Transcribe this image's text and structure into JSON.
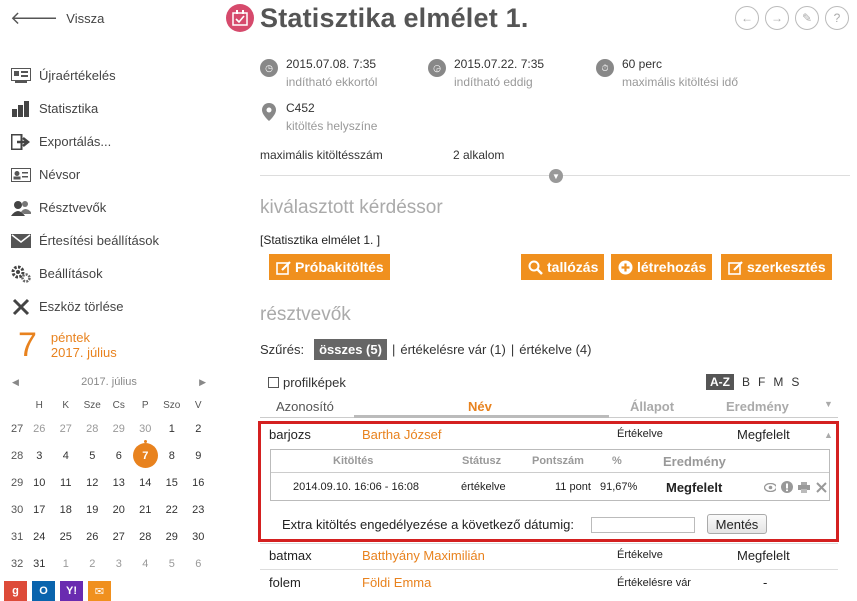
{
  "nav": {
    "back_label": "Vissza",
    "menu": [
      {
        "label": "Újraértékelés",
        "icon": "reevaluate-icon"
      },
      {
        "label": "Statisztika",
        "icon": "bar-chart-icon"
      },
      {
        "label": "Exportálás...",
        "icon": "export-icon"
      },
      {
        "label": "Névsor",
        "icon": "id-card-icon"
      },
      {
        "label": "Résztvevők",
        "icon": "users-icon"
      },
      {
        "label": "Értesítési beállítások",
        "icon": "envelope-icon"
      },
      {
        "label": "Beállítások",
        "icon": "gear-icon"
      },
      {
        "label": "Eszköz törlése",
        "icon": "close-icon"
      }
    ]
  },
  "today": {
    "day": "7",
    "weekday": "péntek",
    "date": "2017. július"
  },
  "calendar": {
    "month_label": "2017. július",
    "prev": "◀",
    "next": "▶",
    "headers": [
      "H",
      "K",
      "Sze",
      "Cs",
      "P",
      "Szo",
      "V"
    ],
    "weeks": [
      {
        "num": "27",
        "days": [
          "26",
          "27",
          "28",
          "29",
          "30",
          "1",
          "2"
        ]
      },
      {
        "num": "28",
        "days": [
          "3",
          "4",
          "5",
          "6",
          "7",
          "8",
          "9"
        ]
      },
      {
        "num": "29",
        "days": [
          "10",
          "11",
          "12",
          "13",
          "14",
          "15",
          "16"
        ]
      },
      {
        "num": "30",
        "days": [
          "17",
          "18",
          "19",
          "20",
          "21",
          "22",
          "23"
        ]
      },
      {
        "num": "31",
        "days": [
          "24",
          "25",
          "26",
          "27",
          "28",
          "29",
          "30"
        ]
      },
      {
        "num": "32",
        "days": [
          "31",
          "1",
          "2",
          "3",
          "4",
          "5",
          "6"
        ]
      }
    ],
    "selected": "7"
  },
  "share": [
    {
      "icon": "google-icon",
      "label": "g",
      "color": "#dd4b39"
    },
    {
      "icon": "outlook-icon",
      "label": "O",
      "color": "#0a64ad"
    },
    {
      "icon": "yahoo-icon",
      "label": "Y!",
      "color": "#6a2bb0"
    },
    {
      "icon": "mail-icon",
      "label": "✉",
      "color": "#f0901e"
    }
  ],
  "page": {
    "title": "Statisztika elmélet 1.",
    "toolbar": [
      "←",
      "→",
      "✎",
      "?"
    ]
  },
  "meta": {
    "start": {
      "value": "2015.07.08. 7:35",
      "label": "indítható ekkortól"
    },
    "end": {
      "value": "2015.07.22. 7:35",
      "label": "indítható eddig"
    },
    "duration": {
      "value": "60 perc",
      "label": "maximális kitöltési idő"
    },
    "location": {
      "value": "C452",
      "label": "kitöltés helyszíne"
    },
    "max_fill_label": "maximális kitöltésszám",
    "max_fill_value": "2 alkalom"
  },
  "questionnaire": {
    "section_title": "kiválasztott kérdéssor",
    "name": "[Statisztika elmélet 1. ]",
    "buttons": {
      "trial": "Próbakitöltés",
      "browse": "tallózás",
      "create": "létrehozás",
      "edit": "szerkesztés"
    }
  },
  "participants": {
    "section_title": "résztvevők",
    "filter_label": "Szűrés:",
    "filter_all": "összes (5)",
    "filter_waiting": "értékelésre vár (1)",
    "filter_done": "értékelve (4)",
    "sep": "|",
    "profile_images": "profilképek",
    "sort": [
      "A-Z",
      "B",
      "F",
      "M",
      "S"
    ],
    "columns": {
      "id": "Azonosító",
      "name": "Név",
      "status": "Állapot",
      "result": "Eredmény"
    },
    "rows": [
      {
        "id": "barjozs",
        "name": "Bartha József",
        "status": "Értékelve",
        "result": "Megfelelt"
      },
      {
        "id": "batmax",
        "name": "Batthyány Maximilián",
        "status": "Értékelve",
        "result": "Megfelelt"
      },
      {
        "id": "folem",
        "name": "Földi Emma",
        "status": "Értékelésre vár",
        "result": "-"
      }
    ],
    "detail": {
      "headers": {
        "fill": "Kitöltés",
        "status": "Státusz",
        "points": "Pontszám",
        "percent": "%",
        "result": "Eredmény"
      },
      "row": {
        "fill": "2014.09.10. 16:06 - 16:08",
        "status": "értékelve",
        "points": "11 pont",
        "percent": "91,67%",
        "result": "Megfelelt"
      },
      "extra_label": "Extra kitöltés engedélyezése a következő dátumig:",
      "extra_value": "",
      "save": "Mentés"
    }
  }
}
